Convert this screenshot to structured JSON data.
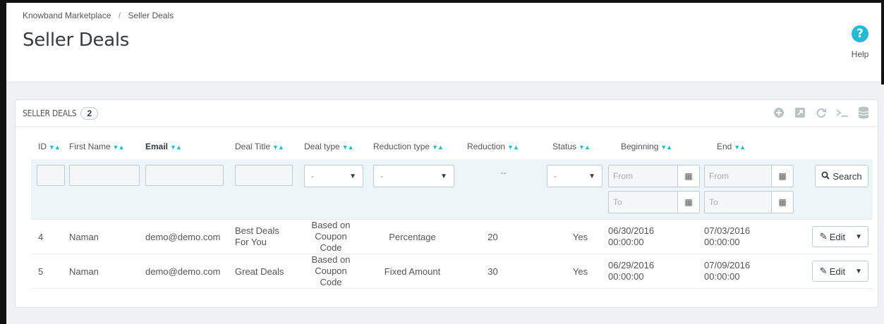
{
  "breadcrumb": {
    "parent": "Knowband Marketplace",
    "separator": "/",
    "current": "Seller Deals"
  },
  "page_title": "Seller Deals",
  "help": {
    "icon": "?",
    "label": "Help"
  },
  "panel": {
    "title": "SELLER DEALS",
    "count": "2"
  },
  "toolbar_icons": [
    "add-icon",
    "export-icon",
    "refresh-icon",
    "sql-query-icon",
    "database-icon"
  ],
  "columns": {
    "id": "ID",
    "first_name": "First Name",
    "email": "Email",
    "deal_title": "Deal Title",
    "deal_type": "Deal type",
    "reduction_type": "Reduction type",
    "reduction": "Reduction",
    "status": "Status",
    "beginning": "Beginning",
    "end": "End"
  },
  "filters": {
    "select_default": "-",
    "reduction_placeholder": "--",
    "from_placeholder": "From",
    "to_placeholder": "To",
    "search_label": "Search"
  },
  "rows": [
    {
      "id": "4",
      "first_name": "Naman",
      "email": "demo@demo.com",
      "deal_title_1": "Best Deals",
      "deal_title_2": "For You",
      "deal_type_1": "Based on",
      "deal_type_2": "Coupon Code",
      "reduction_type": "Percentage",
      "reduction": "20",
      "status": "Yes",
      "beginning_1": "06/30/2016",
      "beginning_2": "00:00:00",
      "end_1": "07/03/2016",
      "end_2": "00:00:00",
      "edit_label": "Edit"
    },
    {
      "id": "5",
      "first_name": "Naman",
      "email": "demo@demo.com",
      "deal_title_1": "Great Deals",
      "deal_title_2": "",
      "deal_type_1": "Based on",
      "deal_type_2": "Coupon Code",
      "reduction_type": "Fixed Amount",
      "reduction": "30",
      "status": "Yes",
      "beginning_1": "06/29/2016",
      "beginning_2": "00:00:00",
      "end_1": "07/09/2016",
      "end_2": "00:00:00",
      "edit_label": "Edit"
    }
  ],
  "colors": {
    "accent": "#25b9d7",
    "filter_bg": "#eef5f9",
    "page_bg": "#eff1f2"
  }
}
